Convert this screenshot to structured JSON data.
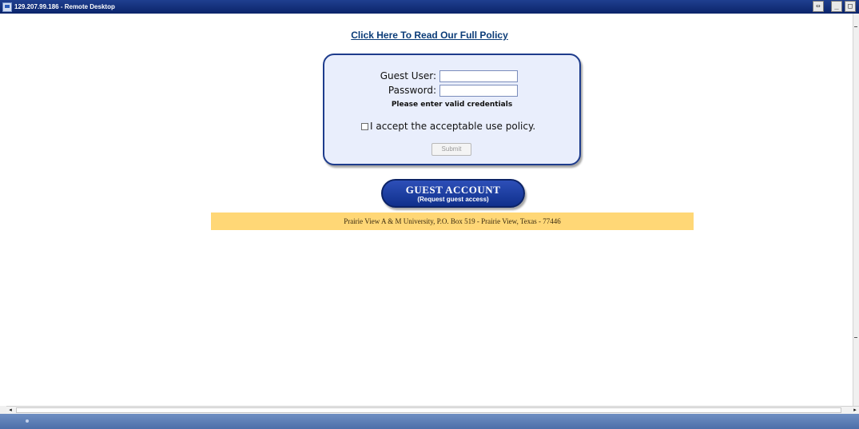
{
  "window": {
    "title": "129.207.99.186 - Remote Desktop",
    "buttons": [
      "⇔",
      "_",
      "□"
    ]
  },
  "page": {
    "policy_link": "Click Here To Read Our Full Policy",
    "login": {
      "guest_user_label": "Guest User:",
      "guest_user_value": "",
      "password_label": "Password:",
      "password_value": "",
      "message": "Please enter valid credentials",
      "accept_label": "I accept the acceptable use policy.",
      "accept_checked": false,
      "submit_label": "Submit"
    },
    "guest_button": {
      "title": "GUEST ACCOUNT",
      "subtitle": "(Request guest access)"
    },
    "footer": "Prairie View A & M University, P.O. Box 519 - Prairie View, Texas - 77446"
  },
  "scrollbar": {
    "left_arrow": "◂",
    "right_arrow": "▸"
  },
  "colors": {
    "titlebar": "#0b246a",
    "login_box_bg": "#e9eefc",
    "login_box_border": "#1e3c8c",
    "guest_button": "#10308c",
    "footer_band": "#ffd776",
    "link": "#0b3c78",
    "taskbar": "#4d6fa9"
  }
}
